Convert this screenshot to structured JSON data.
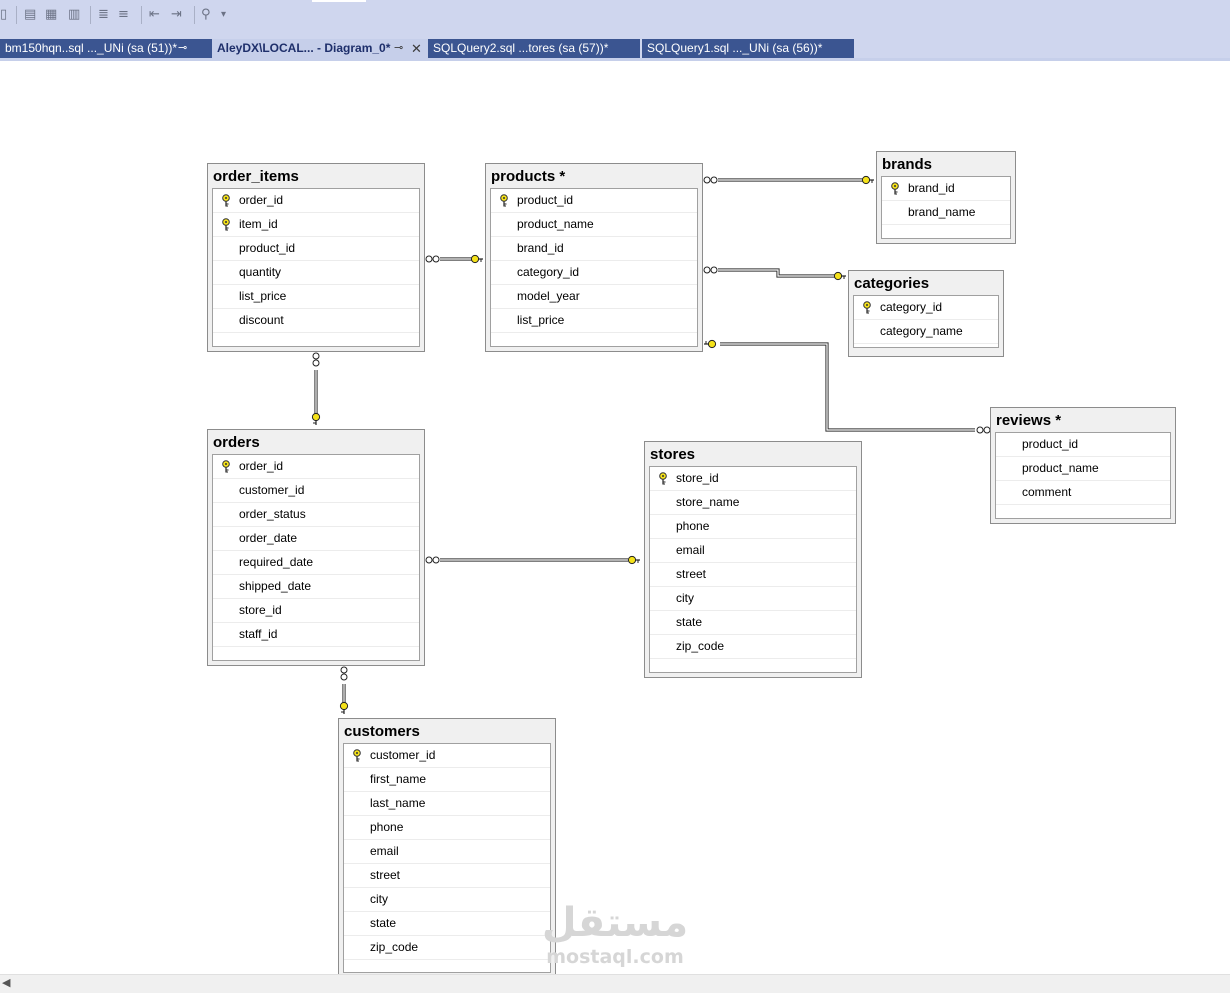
{
  "tabs": [
    {
      "label": "bm150hqn..sql ..._UNi (sa (51))*",
      "pinned": true,
      "active": false
    },
    {
      "label": "AleyDX\\LOCAL... - Diagram_0*",
      "pinned": true,
      "active": true
    },
    {
      "label": "SQLQuery2.sql ...tores (sa (57))*",
      "pinned": false,
      "active": false
    },
    {
      "label": "SQLQuery1.sql ..._UNi (sa (56))*",
      "pinned": false,
      "active": false
    }
  ],
  "tables": {
    "order_items": {
      "title": "order_items",
      "columns": [
        {
          "name": "order_id",
          "pk": true
        },
        {
          "name": "item_id",
          "pk": true
        },
        {
          "name": "product_id",
          "pk": false
        },
        {
          "name": "quantity",
          "pk": false
        },
        {
          "name": "list_price",
          "pk": false
        },
        {
          "name": "discount",
          "pk": false
        }
      ]
    },
    "products": {
      "title": "products *",
      "columns": [
        {
          "name": "product_id",
          "pk": true
        },
        {
          "name": "product_name",
          "pk": false
        },
        {
          "name": "brand_id",
          "pk": false
        },
        {
          "name": "category_id",
          "pk": false
        },
        {
          "name": "model_year",
          "pk": false
        },
        {
          "name": "list_price",
          "pk": false
        }
      ]
    },
    "brands": {
      "title": "brands",
      "columns": [
        {
          "name": "brand_id",
          "pk": true
        },
        {
          "name": "brand_name",
          "pk": false
        }
      ]
    },
    "categories": {
      "title": "categories",
      "columns": [
        {
          "name": "category_id",
          "pk": true
        },
        {
          "name": "category_name",
          "pk": false
        }
      ]
    },
    "reviews": {
      "title": "reviews *",
      "columns": [
        {
          "name": "product_id",
          "pk": false
        },
        {
          "name": "product_name",
          "pk": false
        },
        {
          "name": "comment",
          "pk": false
        }
      ]
    },
    "orders": {
      "title": "orders",
      "columns": [
        {
          "name": "order_id",
          "pk": true
        },
        {
          "name": "customer_id",
          "pk": false
        },
        {
          "name": "order_status",
          "pk": false
        },
        {
          "name": "order_date",
          "pk": false
        },
        {
          "name": "required_date",
          "pk": false
        },
        {
          "name": "shipped_date",
          "pk": false
        },
        {
          "name": "store_id",
          "pk": false
        },
        {
          "name": "staff_id",
          "pk": false
        }
      ]
    },
    "stores": {
      "title": "stores",
      "columns": [
        {
          "name": "store_id",
          "pk": true
        },
        {
          "name": "store_name",
          "pk": false
        },
        {
          "name": "phone",
          "pk": false
        },
        {
          "name": "email",
          "pk": false
        },
        {
          "name": "street",
          "pk": false
        },
        {
          "name": "city",
          "pk": false
        },
        {
          "name": "state",
          "pk": false
        },
        {
          "name": "zip_code",
          "pk": false
        }
      ]
    },
    "customers": {
      "title": "customers",
      "columns": [
        {
          "name": "customer_id",
          "pk": true
        },
        {
          "name": "first_name",
          "pk": false
        },
        {
          "name": "last_name",
          "pk": false
        },
        {
          "name": "phone",
          "pk": false
        },
        {
          "name": "email",
          "pk": false
        },
        {
          "name": "street",
          "pk": false
        },
        {
          "name": "city",
          "pk": false
        },
        {
          "name": "state",
          "pk": false
        },
        {
          "name": "zip_code",
          "pk": false
        }
      ]
    }
  },
  "relationships": [
    {
      "from": "order_items",
      "to": "products"
    },
    {
      "from": "products",
      "to": "brands"
    },
    {
      "from": "products",
      "to": "categories"
    },
    {
      "from": "reviews",
      "to": "products"
    },
    {
      "from": "order_items",
      "to": "orders"
    },
    {
      "from": "orders",
      "to": "stores"
    },
    {
      "from": "orders",
      "to": "customers"
    }
  ],
  "watermark": {
    "arabic": "مستقل",
    "latin": "mostaql.com"
  },
  "colors": {
    "toolbar": "#cfd6ee",
    "tab_inactive": "#3b5591",
    "key_yellow": "#f5e21a"
  }
}
